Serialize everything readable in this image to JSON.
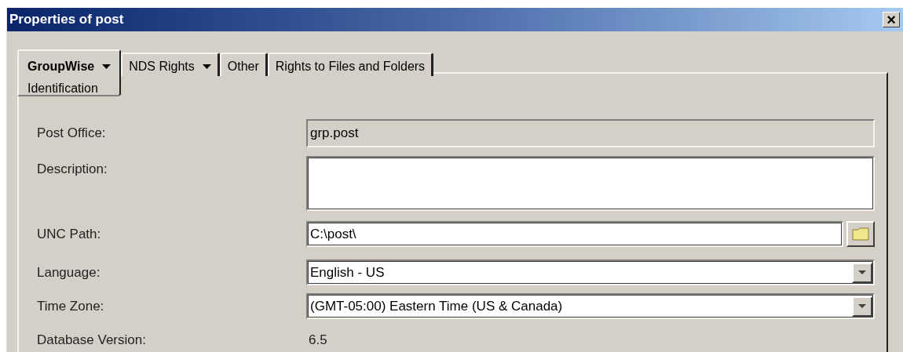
{
  "window": {
    "title": "Properties of post",
    "close": "×"
  },
  "tabs": [
    {
      "label": "GroupWise",
      "sublabel": "Identification",
      "dropdown": true,
      "selected": true
    },
    {
      "label": "NDS Rights",
      "dropdown": true,
      "selected": false
    },
    {
      "label": "Other",
      "dropdown": false,
      "selected": false
    },
    {
      "label": "Rights to Files and Folders",
      "dropdown": false,
      "selected": false
    }
  ],
  "fields": [
    {
      "label": "Post Office:",
      "kind": "readonly",
      "value": "grp.post"
    },
    {
      "label": "Description:",
      "kind": "textarea"
    },
    {
      "label": "UNC Path:",
      "kind": "browse",
      "value": "C:\\post\\"
    },
    {
      "label": "Language:",
      "kind": "select",
      "value": "English - US"
    },
    {
      "label": "Time Zone:",
      "kind": "select",
      "value": "(GMT-05:00) Eastern Time (US & Canada)"
    },
    {
      "label": "Database Version:",
      "kind": "static",
      "value": "6.5"
    }
  ]
}
